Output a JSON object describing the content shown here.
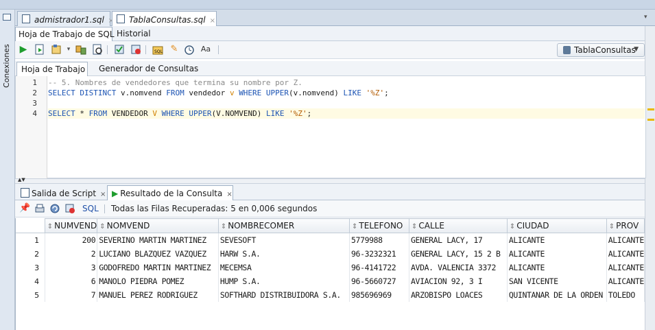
{
  "side": {
    "connections_label": "Conexiones"
  },
  "editor_tabs": [
    {
      "label": "admistrador1.sql",
      "close": "×"
    },
    {
      "label": "TablaConsultas.sql",
      "close": "×"
    }
  ],
  "sub_tabs": {
    "worksheet": "Hoja de Trabajo de SQL",
    "history": "Historial"
  },
  "toolbar": {
    "connection": "TablaConsultas"
  },
  "worksheet_tabs": {
    "worksheet": "Hoja de Trabajo",
    "query_builder": "Generador de Consultas"
  },
  "editor": {
    "line_numbers": [
      "1",
      "2",
      "3",
      "4"
    ],
    "line1": "-- 5. Nombres de vendedores que termina su nombre por Z.",
    "line2": {
      "kw1": "SELECT DISTINCT",
      "t1": " v.nomvend ",
      "kw2": "FROM",
      "t2": " vendedor ",
      "alias": "v",
      "t3": " ",
      "kw3": "WHERE UPPER",
      "t4": "(v.nomvend) ",
      "kw4": "LIKE",
      "t5": " ",
      "str": "'%Z'",
      "t6": ";"
    },
    "line4": {
      "kw1": "SELECT",
      "t1": " * ",
      "kw2": "FROM",
      "t2": " VENDEDOR ",
      "alias": "V",
      "t3": " ",
      "kw3": "WHERE UPPER",
      "t4": "(V.NOMVEND) ",
      "kw4": "LIKE",
      "t5": " ",
      "str": "'%Z'",
      "t6": ";"
    }
  },
  "output_tabs": {
    "script_output": "Salida de Script",
    "query_result": "Resultado de la Consulta",
    "close": "×"
  },
  "result_toolbar": {
    "sql_label": "SQL",
    "status": "Todas las Filas Recuperadas: 5 en 0,006 segundos"
  },
  "grid": {
    "columns": [
      "NUMVEND",
      "NOMVEND",
      "NOMBRECOMER",
      "TELEFONO",
      "CALLE",
      "CIUDAD",
      "PROV"
    ],
    "rows": [
      {
        "n": "1",
        "cells": [
          "200",
          "SEVERINO MARTIN MARTINEZ",
          "SEVESOFT",
          "5779988",
          "GENERAL LACY, 17",
          "ALICANTE",
          "ALICANTE"
        ]
      },
      {
        "n": "2",
        "cells": [
          "2",
          "LUCIANO BLAZQUEZ VAZQUEZ",
          "HARW S.A.",
          "96-3232321",
          "GENERAL LACY, 15 2 B",
          "ALICANTE",
          "ALICANTE"
        ]
      },
      {
        "n": "3",
        "cells": [
          "3",
          "GODOFREDO MARTIN MARTINEZ",
          "MECEMSA",
          "96-4141722",
          "AVDA. VALENCIA 3372",
          "ALICANTE",
          "ALICANTE"
        ]
      },
      {
        "n": "4",
        "cells": [
          "6",
          "MANOLO PIEDRA POMEZ",
          "HUMP S.A.",
          "96-5660727",
          "AVIACION 92, 3 I",
          "SAN VICENTE",
          "ALICANTE"
        ]
      },
      {
        "n": "5",
        "cells": [
          "7",
          "MANUEL PEREZ RODRIGUEZ",
          "SOFTHARD DISTRIBUIDORA S.A.",
          "985696969",
          "ARZOBISPO LOACES",
          "QUINTANAR DE LA ORDEN",
          "TOLEDO"
        ]
      }
    ]
  }
}
